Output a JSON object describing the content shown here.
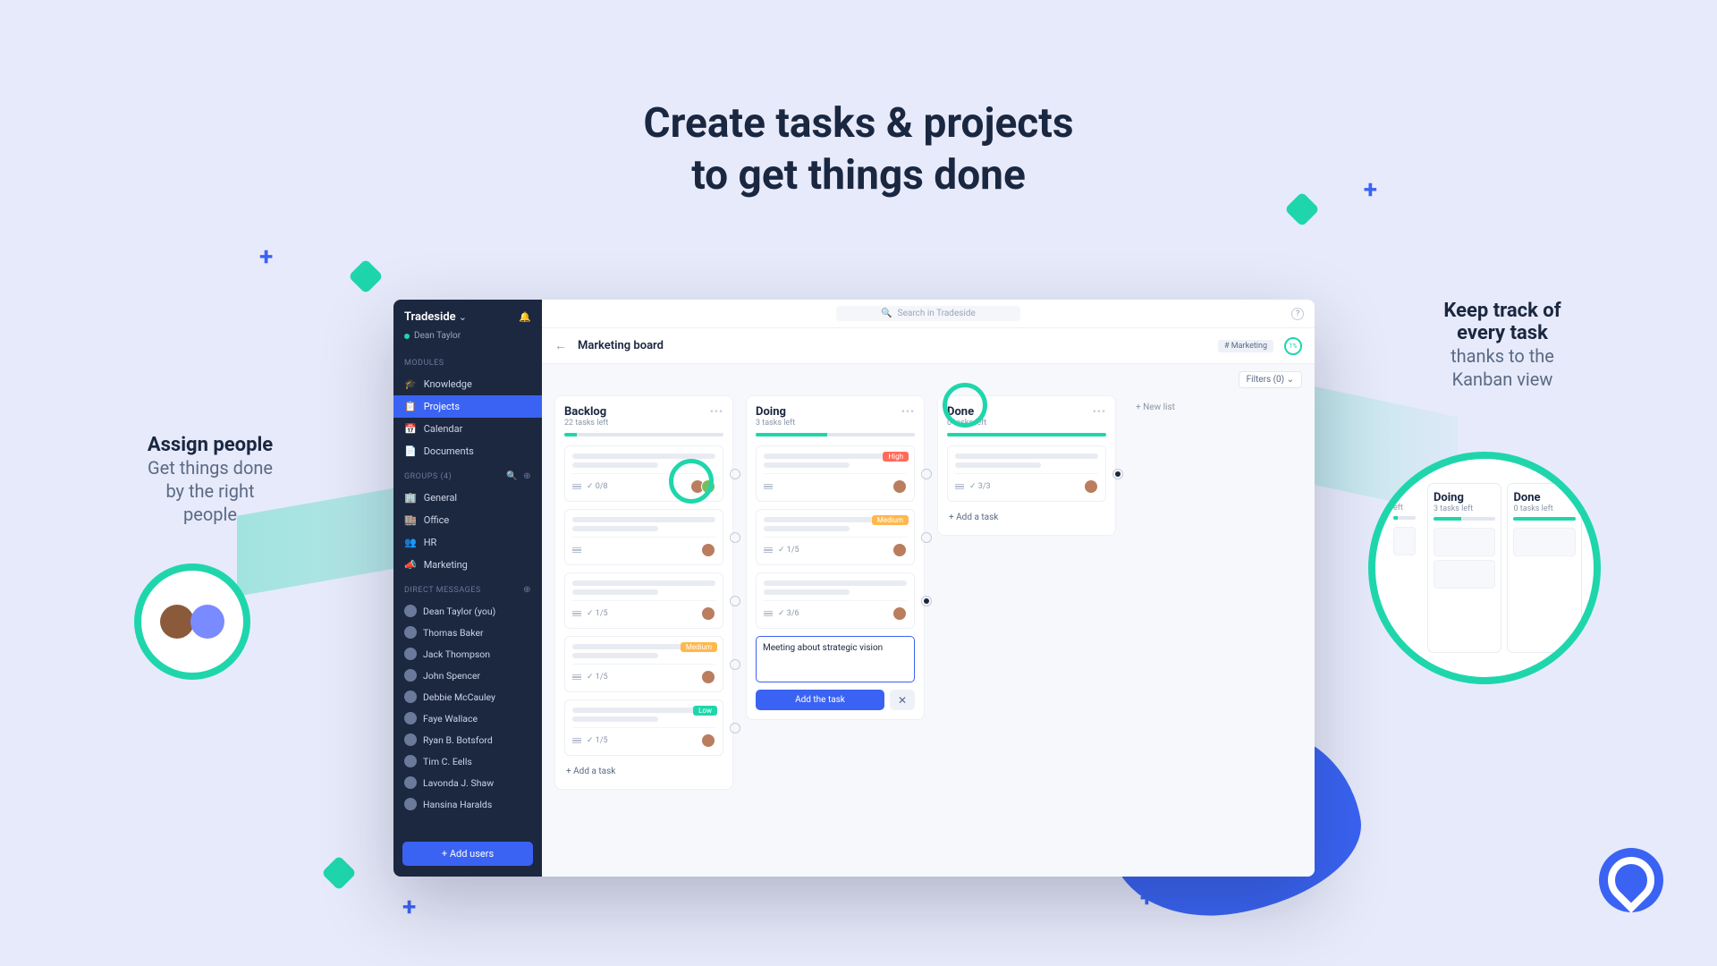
{
  "hero": {
    "line1": "Create tasks & projects",
    "line2": "to get things done"
  },
  "callout_left": {
    "title": "Assign people",
    "line1": "Get things done",
    "line2": "by the right",
    "line3": "people"
  },
  "callout_right": {
    "title": "Keep track of",
    "title2": "every task",
    "line1": "thanks to the",
    "line2": "Kanban view"
  },
  "workspace": {
    "name": "Tradeside",
    "user": "Dean Taylor"
  },
  "search": {
    "placeholder": "Search in Tradeside"
  },
  "sidebar": {
    "modules_label": "MODULES",
    "modules": [
      {
        "icon": "🎓",
        "label": "Knowledge"
      },
      {
        "icon": "📋",
        "label": "Projects"
      },
      {
        "icon": "📅",
        "label": "Calendar"
      },
      {
        "icon": "📄",
        "label": "Documents"
      }
    ],
    "groups_label": "GROUPS (4)",
    "groups": [
      {
        "icon": "🏢",
        "label": "General"
      },
      {
        "icon": "🏬",
        "label": "Office"
      },
      {
        "icon": "👥",
        "label": "HR"
      },
      {
        "icon": "📣",
        "label": "Marketing"
      }
    ],
    "dm_label": "DIRECT MESSAGES",
    "dms": [
      "Dean Taylor (you)",
      "Thomas Baker",
      "Jack Thompson",
      "John Spencer",
      "Debbie McCauley",
      "Faye Wallace",
      "Ryan B. Botsford",
      "Tim C. Eells",
      "Lavonda J. Shaw",
      "Hansina Haralds"
    ],
    "add_users": "+ Add users"
  },
  "page": {
    "title": "Marketing board",
    "tag": "# Marketing",
    "progress": "1%",
    "filter": "Filters (0)",
    "new_list": "+ New list"
  },
  "columns": {
    "backlog": {
      "title": "Backlog",
      "sub": "22 tasks left",
      "add": "+ Add a task"
    },
    "doing": {
      "title": "Doing",
      "sub": "3 tasks left",
      "add": "+ Add a task"
    },
    "done": {
      "title": "Done",
      "sub": "0 tasks left",
      "add": "+ Add a task"
    }
  },
  "cards": {
    "backlog": [
      {
        "check": "0/8",
        "priority": null,
        "avatars": 2
      },
      {
        "check": null,
        "priority": null,
        "avatars": 1
      },
      {
        "check": "1/5",
        "priority": null,
        "avatars": 1
      },
      {
        "check": "1/5",
        "priority": "Medium",
        "avatars": 1
      },
      {
        "check": "1/5",
        "priority": "Low",
        "avatars": 1
      }
    ],
    "doing": [
      {
        "check": null,
        "priority": "High",
        "avatars": 1
      },
      {
        "check": "1/5",
        "priority": "Medium",
        "avatars": 1
      },
      {
        "check": "3/6",
        "priority": null,
        "avatars": 1
      }
    ],
    "done": [
      {
        "check": "3/3",
        "priority": null,
        "avatars": 1
      }
    ]
  },
  "new_task": {
    "text": "Meeting about strategic vision",
    "add": "Add the task",
    "cancel": "✕"
  },
  "bubble_right": {
    "doing": {
      "title": "Doing",
      "sub": "3 tasks left"
    },
    "done": {
      "title": "Done",
      "sub": "0 tasks left"
    }
  }
}
